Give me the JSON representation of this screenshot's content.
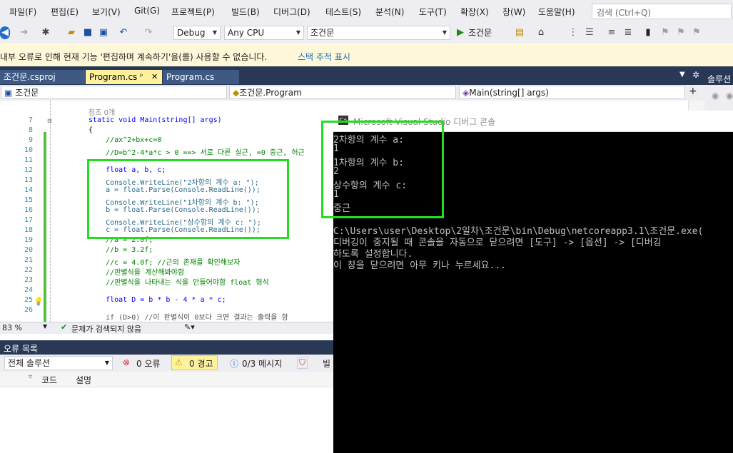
{
  "menu": {
    "items": [
      "파일(F)",
      "편집(E)",
      "보기(V)",
      "Git(G)",
      "프로젝트(P)",
      "빌드(B)",
      "디버그(D)",
      "테스트(S)",
      "분석(N)",
      "도구(T)",
      "확장(X)",
      "창(W)",
      "도움말(H)"
    ],
    "search_placeholder": "검색 (Ctrl+Q)"
  },
  "toolbar": {
    "config": "Debug",
    "platform": "Any CPU",
    "project": "조건문",
    "run_label": "조건문"
  },
  "infobar": {
    "message": "내부 오류로 인해 현재 기능 '편집하며 계속하기'을(를) 사용할 수 없습니다.",
    "link": "스택 추적 표시"
  },
  "tabs": [
    {
      "label": "조건문.csproj"
    },
    {
      "label": "Program.cs",
      "pin": "ᵖ",
      "close": "✕"
    },
    {
      "label": "Program.cs"
    }
  ],
  "solution_explorer_title": "솔루션",
  "nav": {
    "project": "조건문",
    "class": "조건문.Program",
    "member": "Main(string[] args)"
  },
  "editor": {
    "ref_hint": "참조 0개",
    "lines": [
      {
        "n": "7",
        "code": "static void Main(string[] args)"
      },
      {
        "n": "8",
        "code": "{"
      },
      {
        "n": "9",
        "code": "    //ax^2+bx+c=0"
      },
      {
        "n": "10",
        "code": "    //D=b^2-4*a*c > 0 ==> 서로 다른 실근, =0 중근, 허근"
      },
      {
        "n": "11",
        "code": ""
      },
      {
        "n": "12",
        "code": "    float a, b, c;"
      },
      {
        "n": "13",
        "code": "    Console.WriteLine(\"2차항의 계수 a: \");"
      },
      {
        "n": "14",
        "code": "    a = float.Parse(Console.ReadLine());"
      },
      {
        "n": "15",
        "code": "    Console.WriteLine(\"1차항의 계수 b: \");"
      },
      {
        "n": "16",
        "code": "    b = float.Parse(Console.ReadLine());"
      },
      {
        "n": "17",
        "code": "    Console.WriteLine(\"상수항의 계수 c: \");"
      },
      {
        "n": "18",
        "code": "    c = float.Parse(Console.ReadLine());"
      },
      {
        "n": "19",
        "code": "    //a = 2.0f;"
      },
      {
        "n": "20",
        "code": "    //b = 3.2f;"
      },
      {
        "n": "21",
        "code": "    //c = 4.0f; //근의 존재를 확인해보자"
      },
      {
        "n": "22",
        "code": "    //판별식을 계산해봐야함"
      },
      {
        "n": "23",
        "code": "    //판별식을 나타내는 식을 만들어야함 float 형식"
      },
      {
        "n": "24",
        "code": ""
      },
      {
        "n": "25",
        "code": "    float D = b * b - 4 * a * c;"
      },
      {
        "n": "26",
        "code": ""
      }
    ],
    "partial_line": "    if (D>0) //이 판별식이 0보다 크면 결과는 출력을 함"
  },
  "editor_status": {
    "zoom": "83 %",
    "issues": "문제가 검색되지 않음"
  },
  "error_list": {
    "title": "오류 목록",
    "scope": "전체 솔루션",
    "errors": "0 오류",
    "warnings": "0 경고",
    "messages": "0/3 메시지",
    "build_label": "빌",
    "col_code": "코드",
    "col_desc": "설명"
  },
  "console": {
    "title": "Microsoft Visual Studio 디버그 콘솔",
    "lines": [
      "2차항의 계수 a:",
      "1",
      "1차항의 계수 b:",
      "2",
      "상수항의 계수 c:",
      "1",
      "중근",
      "",
      "C:\\Users\\user\\Desktop\\2일차\\조건문\\bin\\Debug\\netcoreapp3.1\\조건문.exe(",
      "디버깅이 중지될 때 콘솔을 자동으로 닫으려면 [도구] -> [옵션] -> [디버깅",
      "하도록 설정합니다.",
      "이 창을 닫으려면 아무 키나 누르세요..."
    ]
  },
  "colors": {
    "highlight": "#22dd22",
    "tab_active": "#fff29d",
    "vs_blue": "#293955"
  }
}
